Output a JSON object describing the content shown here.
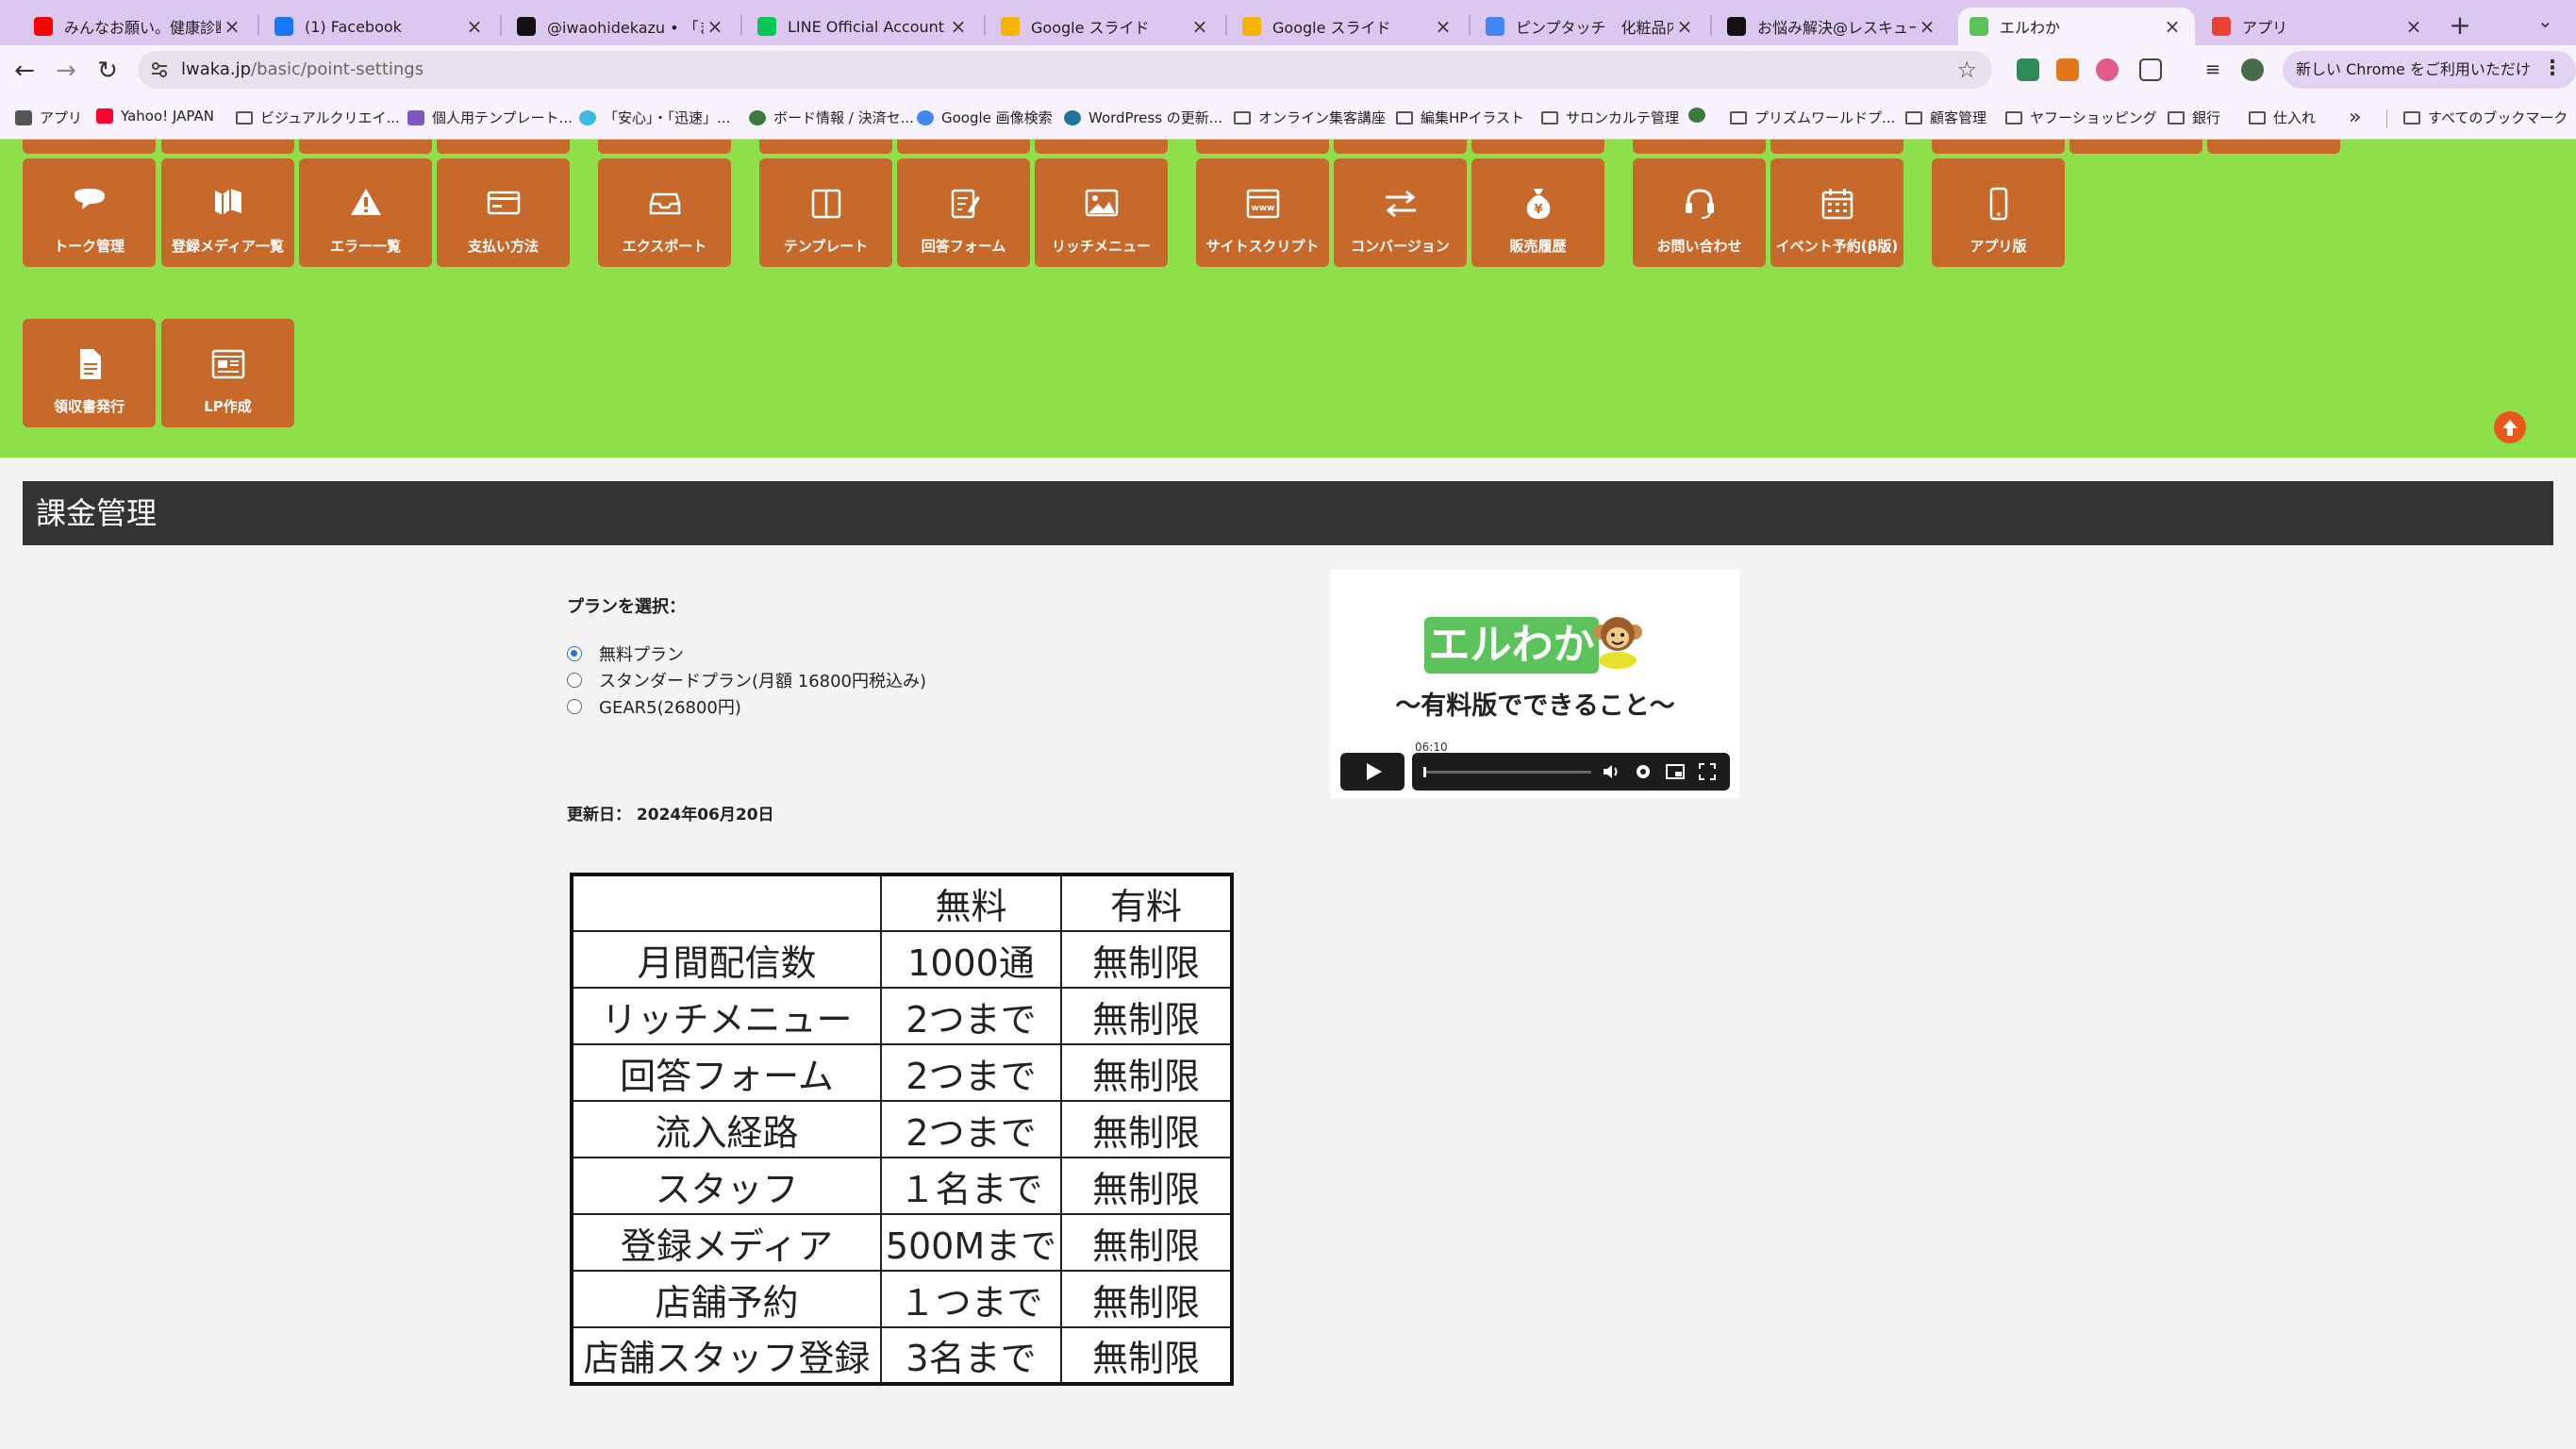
{
  "browser": {
    "tabs": [
      {
        "title": "みんなお願い。健康診断行って",
        "icon_color": "#ff0000",
        "active": false
      },
      {
        "title": "(1) Facebook",
        "icon_color": "#1877f2",
        "active": false
      },
      {
        "title": "@iwaohidekazu • 「またで",
        "icon_color": "#111111",
        "active": false
      },
      {
        "title": "LINE Official Account Ma",
        "icon_color": "#06c755",
        "active": false
      },
      {
        "title": "Google スライド",
        "icon_color": "#f4b400",
        "active": false
      },
      {
        "title": "Google スライド",
        "icon_color": "#f4b400",
        "active": false
      },
      {
        "title": "ピンプタッチ　化粧品内容",
        "icon_color": "#4285f4",
        "active": false
      },
      {
        "title": "お悩み解決@レスキュー美容",
        "icon_color": "#111111",
        "active": false
      },
      {
        "title": "エルわか",
        "icon_color": "#5cc35c",
        "active": true
      },
      {
        "title": "アプリ",
        "icon_color": "#ea4335",
        "active": false
      }
    ],
    "new_tab_label": "+",
    "tab_search_label": "⌄",
    "url_host": "lwaka.jp",
    "url_path": "/basic/point-settings",
    "chrome_update_label": "新しい Chrome をご利用いただけます",
    "bookmarks": [
      {
        "label": "アプリ",
        "icon": "apps-grid"
      },
      {
        "label": "Yahoo! JAPAN",
        "icon": "yahoo"
      },
      {
        "label": "ビジュアルクリエイ...",
        "icon": "folder"
      },
      {
        "label": "個人用テンプレート...",
        "icon": "purple-square"
      },
      {
        "label": "「安心」・「迅速」...",
        "icon": "swirl"
      },
      {
        "label": "ボード情報 / 決済セ...",
        "icon": "globe"
      },
      {
        "label": "Google 画像検索",
        "icon": "google"
      },
      {
        "label": "WordPress の更新...",
        "icon": "wordpress"
      },
      {
        "label": "オンライン集客講座",
        "icon": "folder"
      },
      {
        "label": "編集HPイラスト",
        "icon": "folder"
      },
      {
        "label": "サロンカルテ管理",
        "icon": "folder"
      },
      {
        "label": "",
        "icon": "globe"
      },
      {
        "label": "プリズムワールドプ...",
        "icon": "folder"
      },
      {
        "label": "顧客管理",
        "icon": "folder"
      },
      {
        "label": "ヤフーショッピング",
        "icon": "folder"
      },
      {
        "label": "銀行",
        "icon": "folder"
      },
      {
        "label": "仕入れ",
        "icon": "folder"
      }
    ],
    "bookmarks_more": "»",
    "all_bookmarks_label": "すべてのブックマーク"
  },
  "menu_tiles": [
    {
      "label": "トーク管理",
      "icon": "speech-bubble-icon"
    },
    {
      "label": "登録メディア一覧",
      "icon": "map-icon"
    },
    {
      "label": "エラー一覧",
      "icon": "warning-icon"
    },
    {
      "label": "支払い方法",
      "icon": "credit-card-icon"
    },
    {
      "label": "エクスポート",
      "icon": "inbox-icon"
    },
    {
      "label": "テンプレート",
      "icon": "columns-icon"
    },
    {
      "label": "回答フォーム",
      "icon": "form-edit-icon"
    },
    {
      "label": "リッチメニュー",
      "icon": "image-icon"
    },
    {
      "label": "サイトスクリプト",
      "icon": "browser-www-icon"
    },
    {
      "label": "コンバージョン",
      "icon": "exchange-arrows-icon"
    },
    {
      "label": "販売履歴",
      "icon": "money-bag-icon"
    },
    {
      "label": "お問い合わせ",
      "icon": "headset-icon"
    },
    {
      "label": "イベント予約(β版)",
      "icon": "calendar-icon"
    },
    {
      "label": "アプリ版",
      "icon": "smartphone-icon"
    },
    {
      "label": "領収書発行",
      "icon": "document-icon"
    },
    {
      "label": "LP作成",
      "icon": "webpage-icon"
    }
  ],
  "section_title": "課金管理",
  "plan_select": {
    "title": "プランを選択：",
    "options": [
      {
        "label": "無料プラン",
        "selected": true
      },
      {
        "label": "スタンダードプラン(月額 16800円税込み)",
        "selected": false
      },
      {
        "label": "GEAR5(26800円)",
        "selected": false
      }
    ]
  },
  "updated_label": "更新日： 2024年06月20日",
  "comparison_table": {
    "headers": [
      "",
      "無料",
      "有料"
    ],
    "rows": [
      [
        "月間配信数",
        "1000通",
        "無制限"
      ],
      [
        "リッチメニュー",
        "2つまで",
        "無制限"
      ],
      [
        "回答フォーム",
        "2つまで",
        "無制限"
      ],
      [
        "流入経路",
        "2つまで",
        "無制限"
      ],
      [
        "スタッフ",
        "１名まで",
        "無制限"
      ],
      [
        "登録メディア",
        "500Mまで",
        "無制限"
      ],
      [
        "店舗予約",
        "１つまで",
        "無制限"
      ],
      [
        "店舗スタッフ登録",
        "3名まで",
        "無制限"
      ]
    ]
  },
  "video": {
    "logo_text": "エルわか",
    "subtitle": "〜有料版でできること〜",
    "time": "06:10"
  },
  "colors": {
    "green_bg": "#8ee04a",
    "tile_bg": "#c8692c",
    "section_bar": "#333333",
    "scroll_top": "#e8571c"
  }
}
